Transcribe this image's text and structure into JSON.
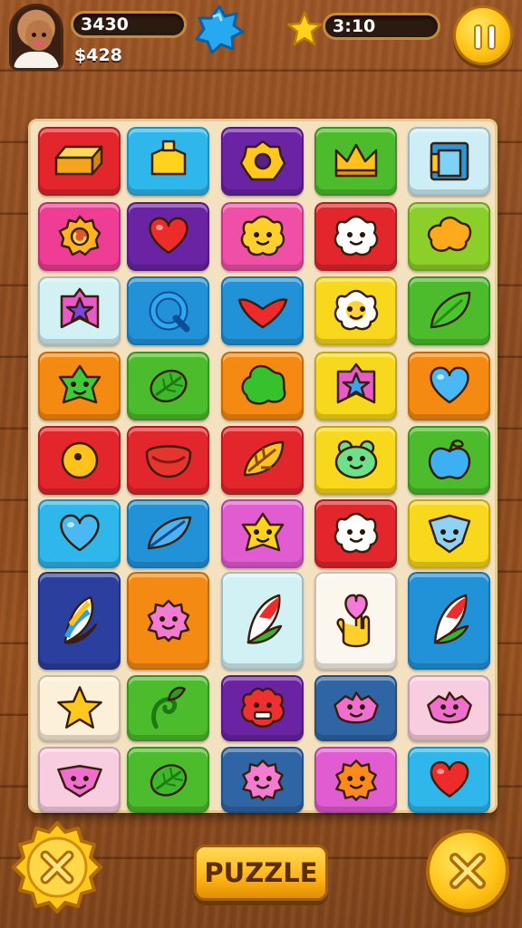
{
  "hud": {
    "score": "3430",
    "coins": "$428",
    "timer": "3:10"
  },
  "icons": {
    "avatar": "player-avatar",
    "blue_star": "blue-star-icon",
    "gold_star": "gold-star-icon",
    "pause": "pause-icon"
  },
  "controls": {
    "puzzle_label": "PUZZLE",
    "left_button_icon": "close-icon",
    "right_button_icon": "close-icon"
  },
  "colors": {
    "red": "#e2262c",
    "cyan": "#2fb6ea",
    "purple": "#6a23a3",
    "green": "#4cbc2c",
    "paleblue": "#cdeef7",
    "pink": "#ef3d96",
    "hotpink": "#f04fa8",
    "orange": "#f58a12",
    "lime": "#8ccf2a",
    "paleaqua": "#d2f1f4",
    "blue": "#2292d8",
    "yellow": "#f8d81c",
    "magenta": "#e05cd0",
    "navy": "#2b3f9e",
    "lightpink": "#f9cde0",
    "cream": "#fdf0d8",
    "steel": "#2f65a4",
    "white": "#fbf6ee"
  },
  "board": {
    "rows": [
      [
        {
          "bg": "red",
          "icon": "gold-bar-icon"
        },
        {
          "bg": "cyan",
          "icon": "yellow-box-icon"
        },
        {
          "bg": "purple",
          "icon": "yellow-donut-icon"
        },
        {
          "bg": "green",
          "icon": "crown-icon"
        },
        {
          "bg": "paleblue",
          "icon": "door-icon"
        }
      ],
      [
        {
          "bg": "pink",
          "icon": "gear-icon"
        },
        {
          "bg": "purple",
          "icon": "heart-icon"
        },
        {
          "bg": "hotpink",
          "icon": "yellow-flower-face-icon"
        },
        {
          "bg": "red",
          "icon": "white-flower-face-icon"
        },
        {
          "bg": "lime",
          "icon": "orange-blob-icon"
        }
      ],
      [
        {
          "bg": "paleaqua",
          "icon": "purple-star-badge-icon"
        },
        {
          "bg": "blue",
          "icon": "q-ring-icon"
        },
        {
          "bg": "blue",
          "icon": "red-heart-chevron-icon"
        },
        {
          "bg": "yellow",
          "icon": "flower-face-icon"
        },
        {
          "bg": "green",
          "icon": "leaf-icon"
        }
      ],
      [
        {
          "bg": "orange",
          "icon": "green-star-face-icon"
        },
        {
          "bg": "green",
          "icon": "green-leaf-icon"
        },
        {
          "bg": "orange",
          "icon": "green-blob-icon"
        },
        {
          "bg": "yellow",
          "icon": "blue-star-badge-icon"
        },
        {
          "bg": "orange",
          "icon": "blue-heart-icon"
        }
      ],
      [
        {
          "bg": "red",
          "icon": "yellow-ball-icon"
        },
        {
          "bg": "red",
          "icon": "bowl-icon"
        },
        {
          "bg": "red",
          "icon": "yellow-leaf-icon"
        },
        {
          "bg": "yellow",
          "icon": "green-frog-icon"
        },
        {
          "bg": "green",
          "icon": "blue-apple-icon"
        }
      ],
      [
        {
          "bg": "cyan",
          "icon": "blue-heart-icon"
        },
        {
          "bg": "blue",
          "icon": "blue-leaf-icon"
        },
        {
          "bg": "magenta",
          "icon": "yellow-star-face-icon"
        },
        {
          "bg": "red",
          "icon": "white-flower-face-icon"
        },
        {
          "bg": "yellow",
          "icon": "blue-shield-face-icon"
        }
      ],
      [
        {
          "bg": "navy",
          "icon": "striped-feather-icon"
        },
        {
          "bg": "orange",
          "icon": "pink-fuzzy-face-icon"
        },
        {
          "bg": "paleaqua",
          "icon": "red-green-feather-icon"
        },
        {
          "bg": "white",
          "icon": "heart-hand-icon"
        },
        {
          "bg": "blue",
          "icon": "red-green-feather-icon"
        }
      ],
      [
        {
          "bg": "cream",
          "icon": "gold-star-icon"
        },
        {
          "bg": "green",
          "icon": "swirl-leaf-icon"
        },
        {
          "bg": "purple",
          "icon": "red-monster-icon"
        },
        {
          "bg": "steel",
          "icon": "pink-face-icon"
        },
        {
          "bg": "lightpink",
          "icon": "pink-face-icon"
        }
      ],
      [
        {
          "bg": "lightpink",
          "icon": "pink-shield-face-icon"
        },
        {
          "bg": "green",
          "icon": "green-leaf-icon"
        },
        {
          "bg": "steel",
          "icon": "pink-fuzzy-face-icon"
        },
        {
          "bg": "magenta",
          "icon": "orange-fuzzy-face-icon"
        },
        {
          "bg": "cyan",
          "icon": "heart-icon"
        }
      ]
    ]
  }
}
